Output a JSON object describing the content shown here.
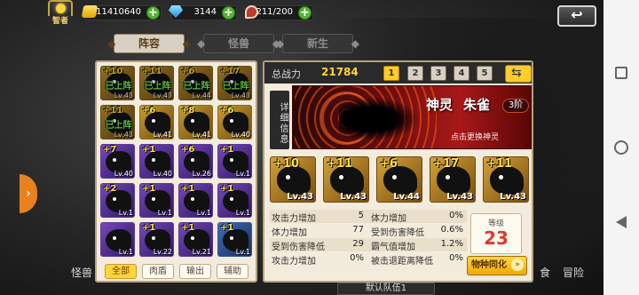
{
  "top": {
    "rank": "智者",
    "gold": "11410640",
    "gems": "3144",
    "food": "211/200",
    "return_label": "↩"
  },
  "tabs": [
    "阵容",
    "怪兽",
    "新生"
  ],
  "roster": [
    {
      "star": "+10",
      "lv": "Lv.43",
      "deployed": "已上阵",
      "color": "gold"
    },
    {
      "star": "+11",
      "lv": "Lv.43",
      "deployed": "已上阵",
      "color": "gold"
    },
    {
      "star": "+6",
      "lv": "Lv.44",
      "deployed": "已上阵",
      "color": "gold"
    },
    {
      "star": "+17",
      "lv": "Lv.43",
      "deployed": "已上阵",
      "color": "gold"
    },
    {
      "star": "+11",
      "lv": "Lv.43",
      "deployed": "已上阵",
      "color": "gold"
    },
    {
      "star": "+6",
      "lv": "Lv.41",
      "deployed": "",
      "color": "gold"
    },
    {
      "star": "+8",
      "lv": "Lv.41",
      "deployed": "",
      "color": "gold"
    },
    {
      "star": "+6",
      "lv": "Lv.40",
      "deployed": "",
      "color": "gold"
    },
    {
      "star": "+7",
      "lv": "Lv.40",
      "deployed": "",
      "color": "purple"
    },
    {
      "star": "+1",
      "lv": "Lv.40",
      "deployed": "",
      "color": "purple"
    },
    {
      "star": "+6",
      "lv": "Lv.26",
      "deployed": "",
      "color": "purple"
    },
    {
      "star": "+1",
      "lv": "Lv.1",
      "deployed": "",
      "color": "purple"
    },
    {
      "star": "+2",
      "lv": "Lv.1",
      "deployed": "",
      "color": "purple"
    },
    {
      "star": "+1",
      "lv": "Lv.1",
      "deployed": "",
      "color": "purple"
    },
    {
      "star": "+1",
      "lv": "Lv.1",
      "deployed": "",
      "color": "purple"
    },
    {
      "star": "+1",
      "lv": "Lv.1",
      "deployed": "",
      "color": "purple"
    },
    {
      "star": "",
      "lv": "Lv.1",
      "deployed": "",
      "color": "purple"
    },
    {
      "star": "+1",
      "lv": "Lv.22",
      "deployed": "",
      "color": "purple"
    },
    {
      "star": "+1",
      "lv": "Lv.21",
      "deployed": "",
      "color": "purple"
    },
    {
      "star": "+1",
      "lv": "Lv.1",
      "deployed": "",
      "color": "blue"
    }
  ],
  "filters": [
    "全部",
    "肉盾",
    "输出",
    "辅助"
  ],
  "power": {
    "label": "总战力",
    "value": "21784"
  },
  "team_tabs": [
    "1",
    "2",
    "3",
    "4",
    "5"
  ],
  "details_label": "详细信息",
  "hero": {
    "tag": "神灵",
    "name": "朱雀",
    "rank": "3阶",
    "change": "点击更换神灵"
  },
  "team": [
    {
      "star": "+10",
      "lv": "Lv.43"
    },
    {
      "star": "+11",
      "lv": "Lv.43"
    },
    {
      "star": "+6",
      "lv": "Lv.44"
    },
    {
      "star": "+17",
      "lv": "Lv.43"
    },
    {
      "star": "+11",
      "lv": "Lv.43"
    }
  ],
  "stats_left": [
    {
      "k": "攻击力增加",
      "v": "5"
    },
    {
      "k": "体力增加",
      "v": "77"
    },
    {
      "k": "受到伤害降低",
      "v": "29"
    },
    {
      "k": "攻击力增加",
      "v": "0%"
    }
  ],
  "stats_right": [
    {
      "k": "体力增加",
      "v": "0%"
    },
    {
      "k": "受到伤害降低",
      "v": "0.6%"
    },
    {
      "k": "霸气值增加",
      "v": "1.2%"
    },
    {
      "k": "被击退距离降低",
      "v": "0%"
    }
  ],
  "level": {
    "label": "等级",
    "value": "23"
  },
  "assimilate_label": "物种同化",
  "default_team": "默认队伍1",
  "side": {
    "left_menu": "怪兽",
    "right_menu": "冒险",
    "right_menu2": "食"
  }
}
